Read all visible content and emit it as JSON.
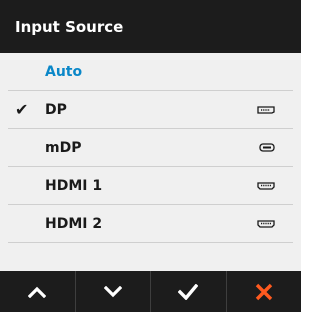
{
  "header": {
    "title": "Input Source"
  },
  "menu": {
    "items": [
      {
        "label": "Auto",
        "checked": false,
        "selected": true,
        "icon": ""
      },
      {
        "label": "DP",
        "checked": true,
        "selected": false,
        "icon": "displayport-port-icon"
      },
      {
        "label": "mDP",
        "checked": false,
        "selected": false,
        "icon": "mini-displayport-port-icon"
      },
      {
        "label": "HDMI 1",
        "checked": false,
        "selected": false,
        "icon": "hdmi-port-icon"
      },
      {
        "label": "HDMI 2",
        "checked": false,
        "selected": false,
        "icon": "hdmi-port-icon"
      }
    ]
  },
  "footer": {
    "buttons": [
      {
        "name": "up-button",
        "icon": "chevron-up-icon"
      },
      {
        "name": "down-button",
        "icon": "chevron-down-icon"
      },
      {
        "name": "confirm-button",
        "icon": "check-icon"
      },
      {
        "name": "close-button",
        "icon": "close-icon"
      }
    ]
  },
  "colors": {
    "header_bg": "#1c1c1c",
    "menu_bg": "#f0f0f0",
    "selected_text": "#0a87c8",
    "close_accent": "#ff5a1f"
  }
}
